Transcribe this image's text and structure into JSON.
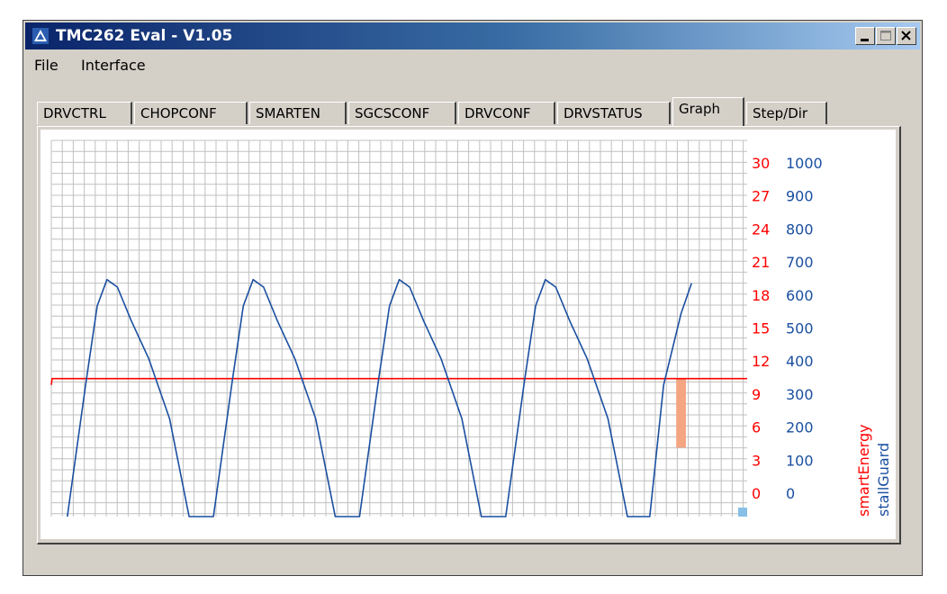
{
  "window": {
    "title": "TMC262 Eval - V1.05",
    "icon": "app-logo-icon",
    "controls": [
      "minimize-icon",
      "maximize-icon",
      "close-icon"
    ]
  },
  "menu": [
    {
      "label": "File"
    },
    {
      "label": "Interface"
    }
  ],
  "tabs": [
    {
      "label": "DRVCTRL",
      "active": false
    },
    {
      "label": "CHOPCONF",
      "active": false
    },
    {
      "label": "SMARTEN",
      "active": false
    },
    {
      "label": "SGCSCONF",
      "active": false
    },
    {
      "label": "DRVCONF",
      "active": false
    },
    {
      "label": "DRVSTATUS",
      "active": false
    },
    {
      "label": "Graph",
      "active": true
    },
    {
      "label": "Step/Dir",
      "active": false
    }
  ],
  "graph": {
    "smartEnergy_axis": {
      "label": "smartEnergy",
      "color": "#ff0000",
      "ticks": [
        "30",
        "27",
        "24",
        "21",
        "18",
        "15",
        "12",
        "9",
        "6",
        "3",
        "0"
      ]
    },
    "stallGuard_axis": {
      "label": "stallGuard",
      "color": "#1a4fa0",
      "ticks": [
        "1000",
        "900",
        "800",
        "700",
        "600",
        "500",
        "400",
        "300",
        "200",
        "100",
        "0"
      ]
    },
    "grid_color": "#c0c0c0",
    "bar_color": "#f4a582",
    "marker_color": "#87bfe6"
  },
  "chart_data": {
    "type": "line",
    "grid": true,
    "y_left_range": [
      0,
      30
    ],
    "y_right_range": [
      0,
      1000
    ],
    "series": [
      {
        "name": "smartEnergy",
        "axis": "left",
        "color": "#ff0000",
        "points": [
          [
            0,
            10.5
          ],
          [
            0.1,
            11
          ],
          [
            98,
            11
          ],
          [
            100,
            11
          ]
        ]
      },
      {
        "name": "stallGuard",
        "axis": "right",
        "color": "#1a4fa0",
        "points": [
          [
            2.3,
            0
          ],
          [
            5,
            360
          ],
          [
            6.6,
            560
          ],
          [
            8,
            630
          ],
          [
            9.5,
            610
          ],
          [
            11.5,
            520
          ],
          [
            14,
            420
          ],
          [
            17,
            260
          ],
          [
            19.8,
            0
          ],
          [
            23.3,
            0
          ],
          [
            26,
            360
          ],
          [
            27.6,
            560
          ],
          [
            29,
            630
          ],
          [
            30.5,
            610
          ],
          [
            32.5,
            520
          ],
          [
            35,
            420
          ],
          [
            38,
            260
          ],
          [
            40.8,
            0
          ],
          [
            44.3,
            0
          ],
          [
            47,
            360
          ],
          [
            48.6,
            560
          ],
          [
            50,
            630
          ],
          [
            51.5,
            610
          ],
          [
            53.5,
            520
          ],
          [
            56,
            420
          ],
          [
            59,
            260
          ],
          [
            61.8,
            0
          ],
          [
            65.3,
            0
          ],
          [
            68,
            360
          ],
          [
            69.6,
            560
          ],
          [
            71,
            630
          ],
          [
            72.5,
            610
          ],
          [
            74.5,
            520
          ],
          [
            77,
            420
          ],
          [
            80,
            260
          ],
          [
            82.8,
            0
          ],
          [
            86,
            0
          ],
          [
            88,
            350
          ],
          [
            90.5,
            540
          ],
          [
            92,
            620
          ]
        ]
      }
    ],
    "bars": [
      {
        "axis": "left",
        "y_from": 5.5,
        "y_to": 11,
        "x_from": 89.8,
        "x_to": 91.2,
        "color": "#f4a582"
      }
    ]
  }
}
